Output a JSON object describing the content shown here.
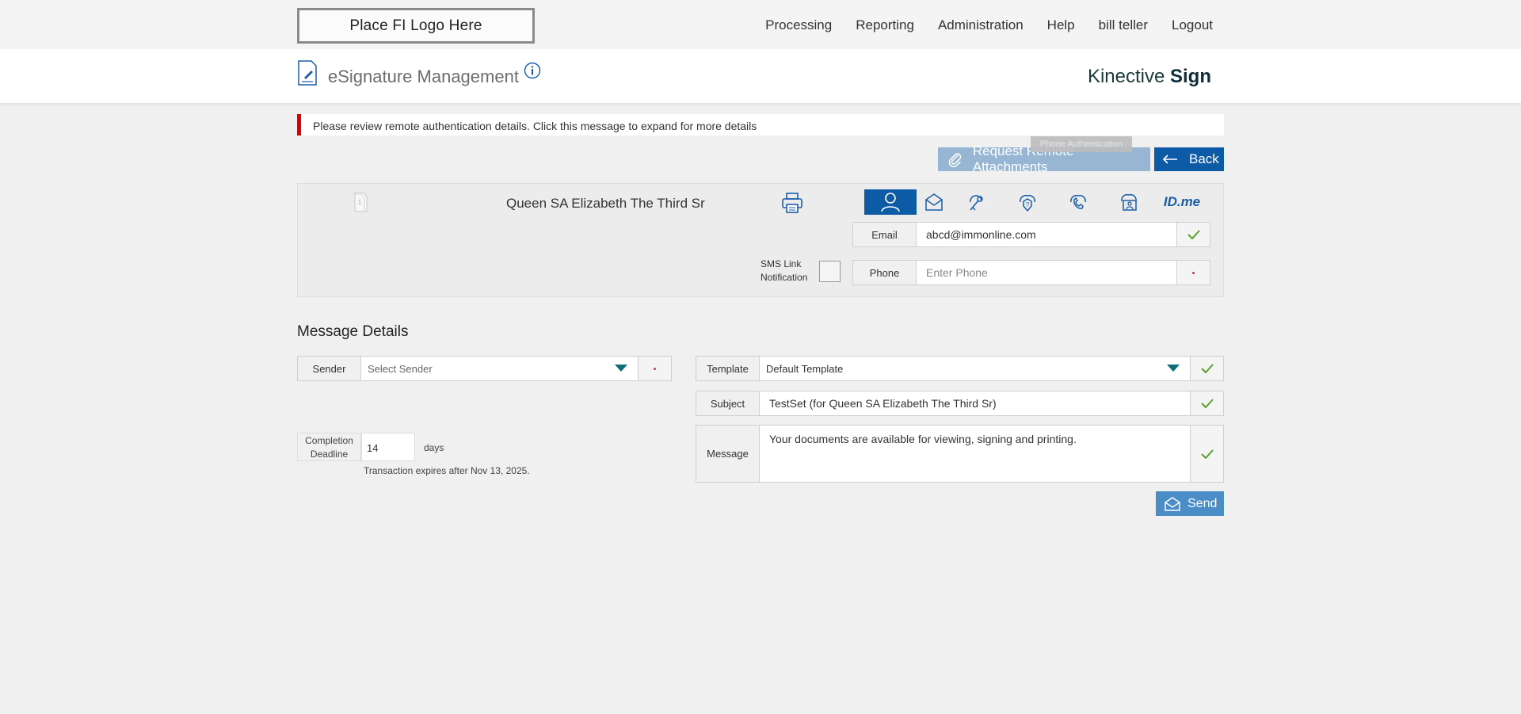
{
  "topbar": {
    "logo_text": "Place FI Logo Here",
    "nav": [
      "Processing",
      "Reporting",
      "Administration",
      "Help",
      "bill teller",
      "Logout"
    ]
  },
  "header": {
    "title": "eSignature Management",
    "brand_light": "Kinective",
    "brand_bold": "Sign"
  },
  "alert": {
    "text": "Please review remote authentication details. Click this message to expand for more details",
    "color": "#e00000"
  },
  "actions": {
    "tooltip": "Phone Authentication",
    "request_attachments_label": "Request Remote Attachments",
    "back_label": "Back"
  },
  "signer": {
    "page_number": "1",
    "name": "Queen SA Elizabeth The Third Sr",
    "auth_methods": [
      "person-icon",
      "email-icon",
      "key-icon",
      "question-shield-icon",
      "phone-icon",
      "id-card-icon",
      "idme-icon"
    ],
    "idme_text": "ID.me",
    "email": {
      "label": "Email",
      "value": "abcd@immonline.com"
    },
    "phone": {
      "label": "Phone",
      "placeholder": "Enter Phone"
    },
    "sms": {
      "line1": "SMS Link",
      "line2": "Notification"
    }
  },
  "message_details": {
    "title": "Message Details",
    "sender": {
      "label": "Sender",
      "placeholder": "Select Sender"
    },
    "template": {
      "label": "Template",
      "value": "Default Template"
    },
    "subject": {
      "label": "Subject",
      "value": "TestSet (for Queen SA Elizabeth The Third Sr)"
    },
    "message": {
      "label": "Message",
      "value": "Your documents are available for viewing, signing and printing."
    },
    "deadline": {
      "label_line1": "Completion",
      "label_line2": "Deadline",
      "value": "14",
      "unit": "days",
      "note": "Transaction expires after Nov 13, 2025."
    },
    "send_label": "Send"
  },
  "colors": {
    "primary": "#0d5aa7",
    "primary_light": "#96b6d3",
    "send": "#4b8ec7",
    "check": "#5aa02c"
  }
}
